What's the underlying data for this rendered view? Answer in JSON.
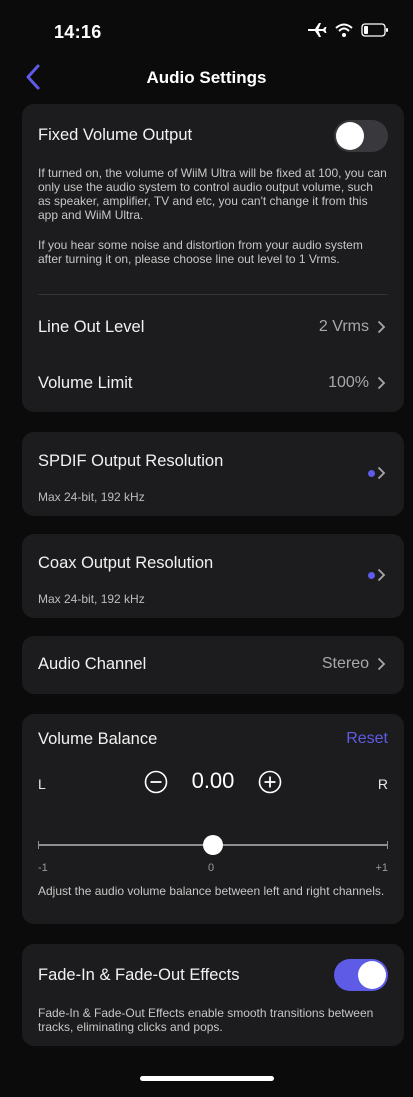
{
  "status_bar": {
    "time": "14:16"
  },
  "nav": {
    "title": "Audio Settings"
  },
  "fixed_volume": {
    "title": "Fixed Volume Output",
    "toggle_on": false,
    "description_1": "If turned on, the volume of WiiM Ultra will be fixed at 100, you can only use the audio system to control audio output volume, such as speaker, amplifier, TV and etc, you can't change it from this app and WiiM Ultra.",
    "description_2": "If you hear some noise and distortion from your audio system after turning it on, please choose line out level to 1 Vrms."
  },
  "line_out": {
    "title": "Line Out Level",
    "value": "2 Vrms"
  },
  "volume_limit": {
    "title": "Volume Limit",
    "value": "100%"
  },
  "spdif": {
    "title": "SPDIF Output Resolution",
    "subtitle": "Max 24-bit, 192 kHz"
  },
  "coax": {
    "title": "Coax Output Resolution",
    "subtitle": "Max 24-bit, 192 kHz"
  },
  "audio_channel": {
    "title": "Audio Channel",
    "value": "Stereo"
  },
  "balance": {
    "title": "Volume Balance",
    "reset_label": "Reset",
    "left_label": "L",
    "right_label": "R",
    "value": "0.00",
    "slider_position": 0.0,
    "min_label": "-1",
    "mid_label": "0",
    "max_label": "+1",
    "description": "Adjust the audio volume balance between left and right channels."
  },
  "fade": {
    "title": "Fade-In & Fade-Out Effects",
    "toggle_on": true,
    "description": "Fade-In & Fade-Out Effects enable smooth transitions between tracks, eliminating clicks and pops."
  },
  "colors": {
    "accent": "#5e5ce6",
    "card": "#1c1c1e",
    "background": "#0b0b0b"
  }
}
